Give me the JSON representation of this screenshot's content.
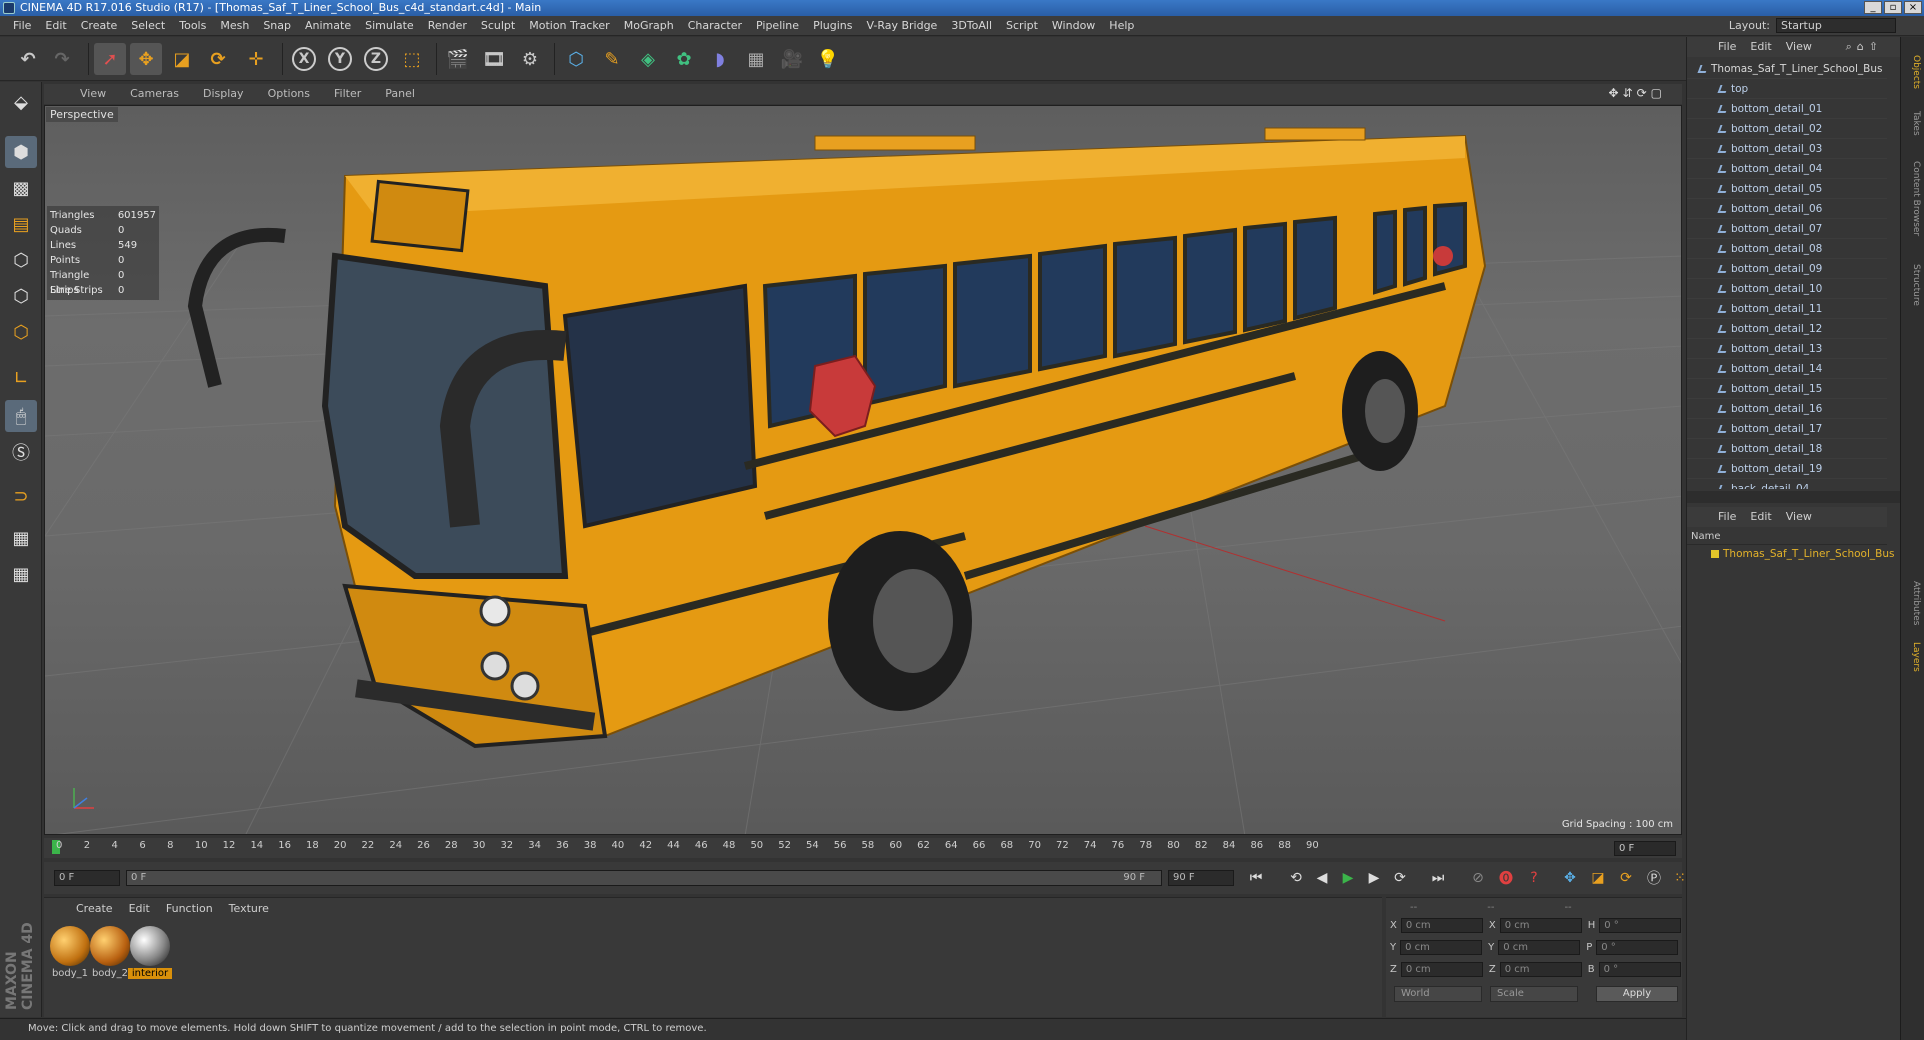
{
  "window": {
    "title": "CINEMA 4D R17.016 Studio (R17) - [Thomas_Saf_T_Liner_School_Bus_c4d_standart.c4d] - Main"
  },
  "menubar": {
    "items": [
      "File",
      "Edit",
      "Create",
      "Select",
      "Tools",
      "Mesh",
      "Snap",
      "Animate",
      "Simulate",
      "Render",
      "Sculpt",
      "Motion Tracker",
      "MoGraph",
      "Character",
      "Pipeline",
      "Plugins",
      "V-Ray Bridge",
      "3DToAll",
      "Script",
      "Window",
      "Help"
    ],
    "layout_label": "Layout:",
    "layout_value": "Startup"
  },
  "toolbar": {
    "icons": [
      "undo-icon",
      "redo-icon",
      "live-selection-icon",
      "move-icon",
      "scale-icon",
      "rotate-icon",
      "add-icon",
      "x-axis-icon",
      "y-axis-icon",
      "z-axis-icon",
      "coordinate-system-icon",
      "render-view-icon",
      "render-to-picture-viewer-icon",
      "render-settings-icon",
      "cube-icon",
      "pen-icon",
      "subdivision-icon",
      "array-icon",
      "deformer-icon",
      "floor-icon",
      "camera-icon",
      "light-icon"
    ],
    "axis_labels": [
      "X",
      "Y",
      "Z"
    ]
  },
  "viewport": {
    "menu": [
      "View",
      "Cameras",
      "Display",
      "Options",
      "Filter",
      "Panel"
    ],
    "label": "Perspective",
    "stats": [
      {
        "k": "Triangles",
        "v": "601957"
      },
      {
        "k": "Quads",
        "v": "0"
      },
      {
        "k": "Lines",
        "v": "549"
      },
      {
        "k": "Points",
        "v": "0"
      },
      {
        "k": "Triangle Strips",
        "v": "0"
      },
      {
        "k": "Line Strips",
        "v": "0"
      }
    ],
    "grid_spacing": "Grid Spacing : 100 cm",
    "colors": {
      "bus_body": "#e59a12",
      "bus_stripe": "#2a2a22",
      "bus_window": "#223a5c",
      "stop_sign": "#c83a3a"
    }
  },
  "timeline": {
    "ticks": [
      "0",
      "2",
      "4",
      "6",
      "8",
      "10",
      "12",
      "14",
      "16",
      "18",
      "20",
      "22",
      "24",
      "26",
      "28",
      "30",
      "32",
      "34",
      "36",
      "38",
      "40",
      "42",
      "44",
      "46",
      "48",
      "50",
      "52",
      "54",
      "56",
      "58",
      "60",
      "62",
      "64",
      "66",
      "68",
      "70",
      "72",
      "74",
      "76",
      "78",
      "80",
      "82",
      "84",
      "86",
      "88",
      "90"
    ],
    "current_frame": "0 F"
  },
  "playbar": {
    "start": "0 F",
    "min": "0 F",
    "max": "90 F",
    "end": "90 F"
  },
  "materials": {
    "menu": [
      "Create",
      "Edit",
      "Function",
      "Texture"
    ],
    "items": [
      {
        "name": "body_1",
        "selected": false
      },
      {
        "name": "body_2",
        "selected": false
      },
      {
        "name": "interior",
        "selected": true
      }
    ]
  },
  "coords": {
    "header": [
      "--",
      "--",
      "--"
    ],
    "rows": [
      {
        "a": "X",
        "av": "0 cm",
        "b": "X",
        "bv": "0 cm",
        "c": "H",
        "cv": "0 °"
      },
      {
        "a": "Y",
        "av": "0 cm",
        "b": "Y",
        "bv": "0 cm",
        "c": "P",
        "cv": "0 °"
      },
      {
        "a": "Z",
        "av": "0 cm",
        "b": "Z",
        "bv": "0 cm",
        "c": "B",
        "cv": "0 °"
      }
    ],
    "world": "World",
    "scale": "Scale",
    "apply": "Apply"
  },
  "brand": "MAXON CINEMA 4D",
  "status": "Move: Click and drag to move elements. Hold down SHIFT to quantize movement / add to the selection in point mode, CTRL to remove.",
  "objects": {
    "menu": [
      "File",
      "Edit",
      "View"
    ],
    "root": "Thomas_Saf_T_Liner_School_Bus",
    "items": [
      "top",
      "bottom_detail_01",
      "bottom_detail_02",
      "bottom_detail_03",
      "bottom_detail_04",
      "bottom_detail_05",
      "bottom_detail_06",
      "bottom_detail_07",
      "bottom_detail_08",
      "bottom_detail_09",
      "bottom_detail_10",
      "bottom_detail_11",
      "bottom_detail_12",
      "bottom_detail_13",
      "bottom_detail_14",
      "bottom_detail_15",
      "bottom_detail_16",
      "bottom_detail_17",
      "bottom_detail_18",
      "bottom_detail_19",
      "back_detail_04"
    ]
  },
  "layers": {
    "menu": [
      "File",
      "Edit",
      "View"
    ],
    "header": "Name",
    "items": [
      "Thomas_Saf_T_Liner_School_Bus"
    ]
  },
  "side_tabs": {
    "top": [
      "Objects",
      "Takes",
      "Content Browser",
      "Structure"
    ],
    "bottom": [
      "Attributes",
      "Layers"
    ]
  }
}
